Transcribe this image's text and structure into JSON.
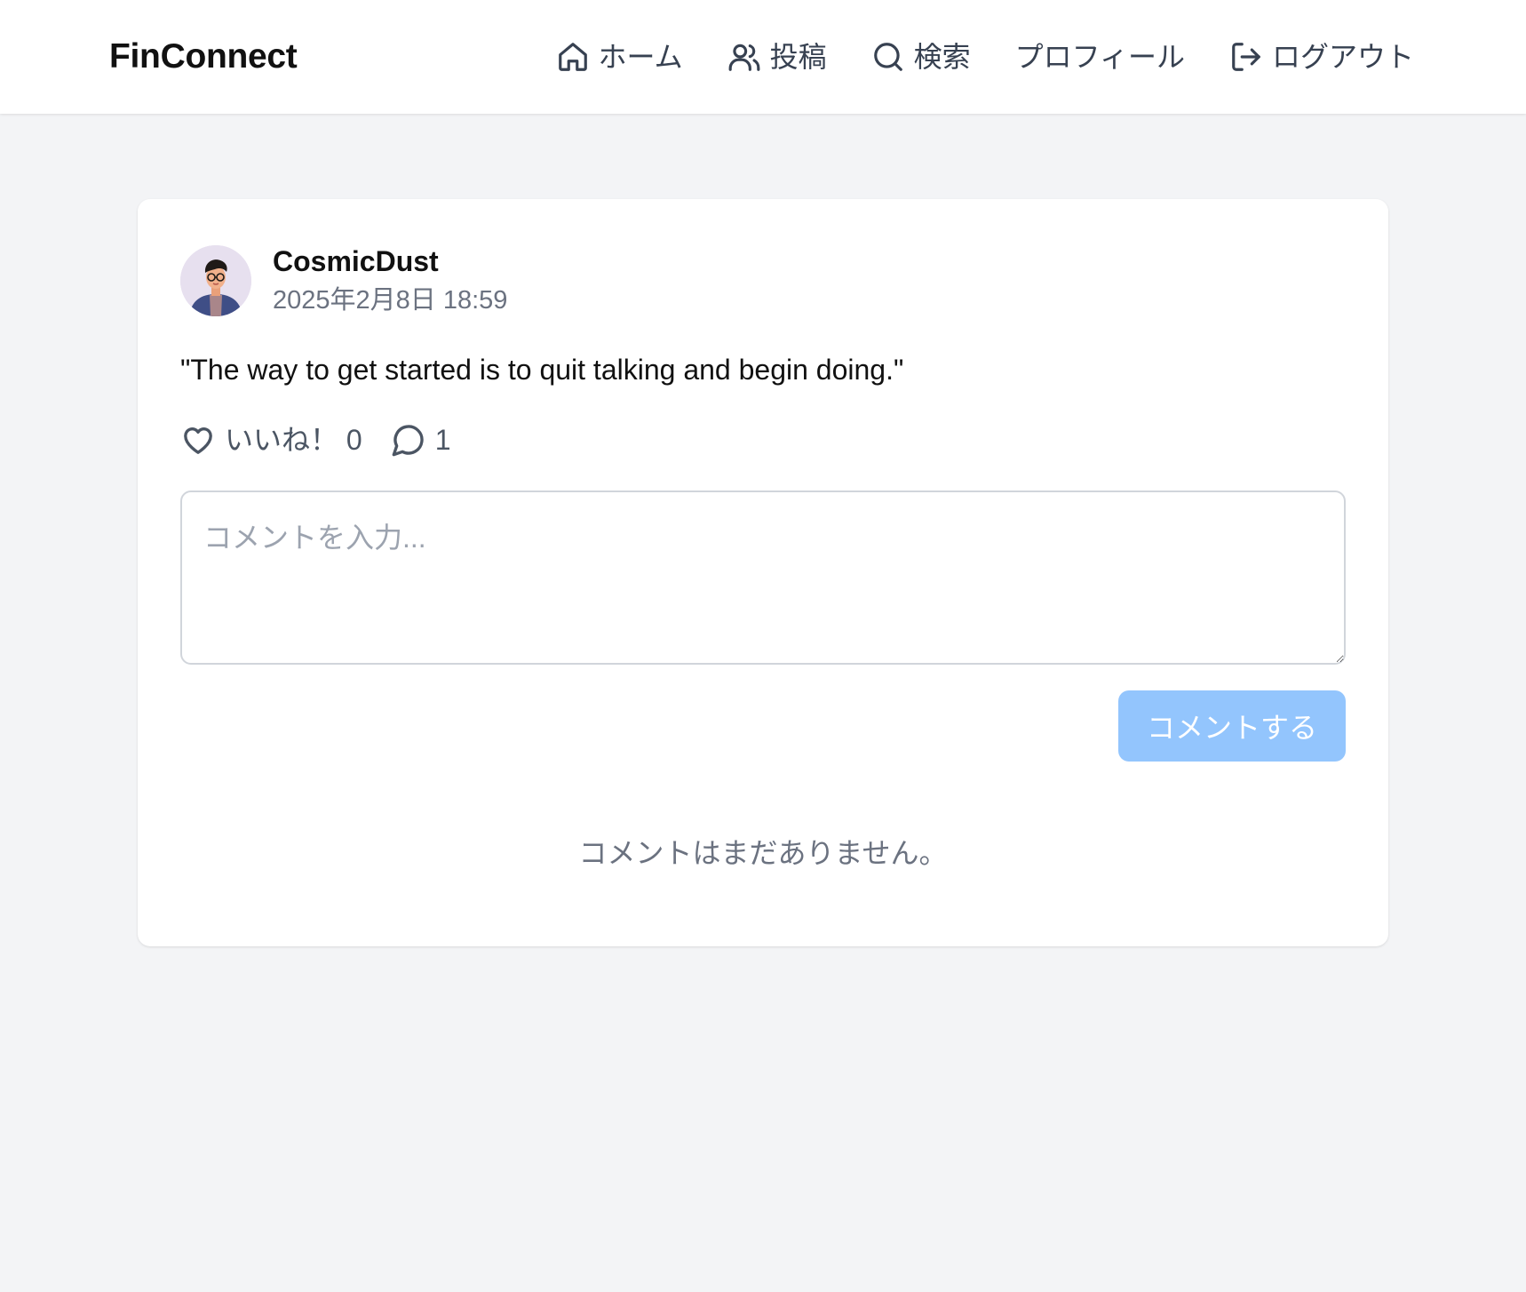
{
  "header": {
    "brand": "FinConnect",
    "nav": [
      {
        "label": "ホーム",
        "icon": "home-icon"
      },
      {
        "label": "投稿",
        "icon": "users-icon"
      },
      {
        "label": "検索",
        "icon": "search-icon"
      },
      {
        "label": "プロフィール",
        "icon": ""
      },
      {
        "label": "ログアウト",
        "icon": "logout-icon"
      }
    ]
  },
  "post": {
    "author": "CosmicDust",
    "timestamp": "2025年2月8日 18:59",
    "body": "\"The way to get started is to quit talking and begin doing.\"",
    "like_label": "いいね！ 0",
    "comment_count": "1"
  },
  "comment_form": {
    "placeholder": "コメントを入力...",
    "value": "",
    "submit_label": "コメントする"
  },
  "comments": {
    "empty_message": "コメントはまだありません。"
  },
  "colors": {
    "page_bg": "#f3f4f6",
    "card_bg": "#ffffff",
    "submit_disabled": "#93c5fd",
    "muted_text": "#6b7280"
  }
}
